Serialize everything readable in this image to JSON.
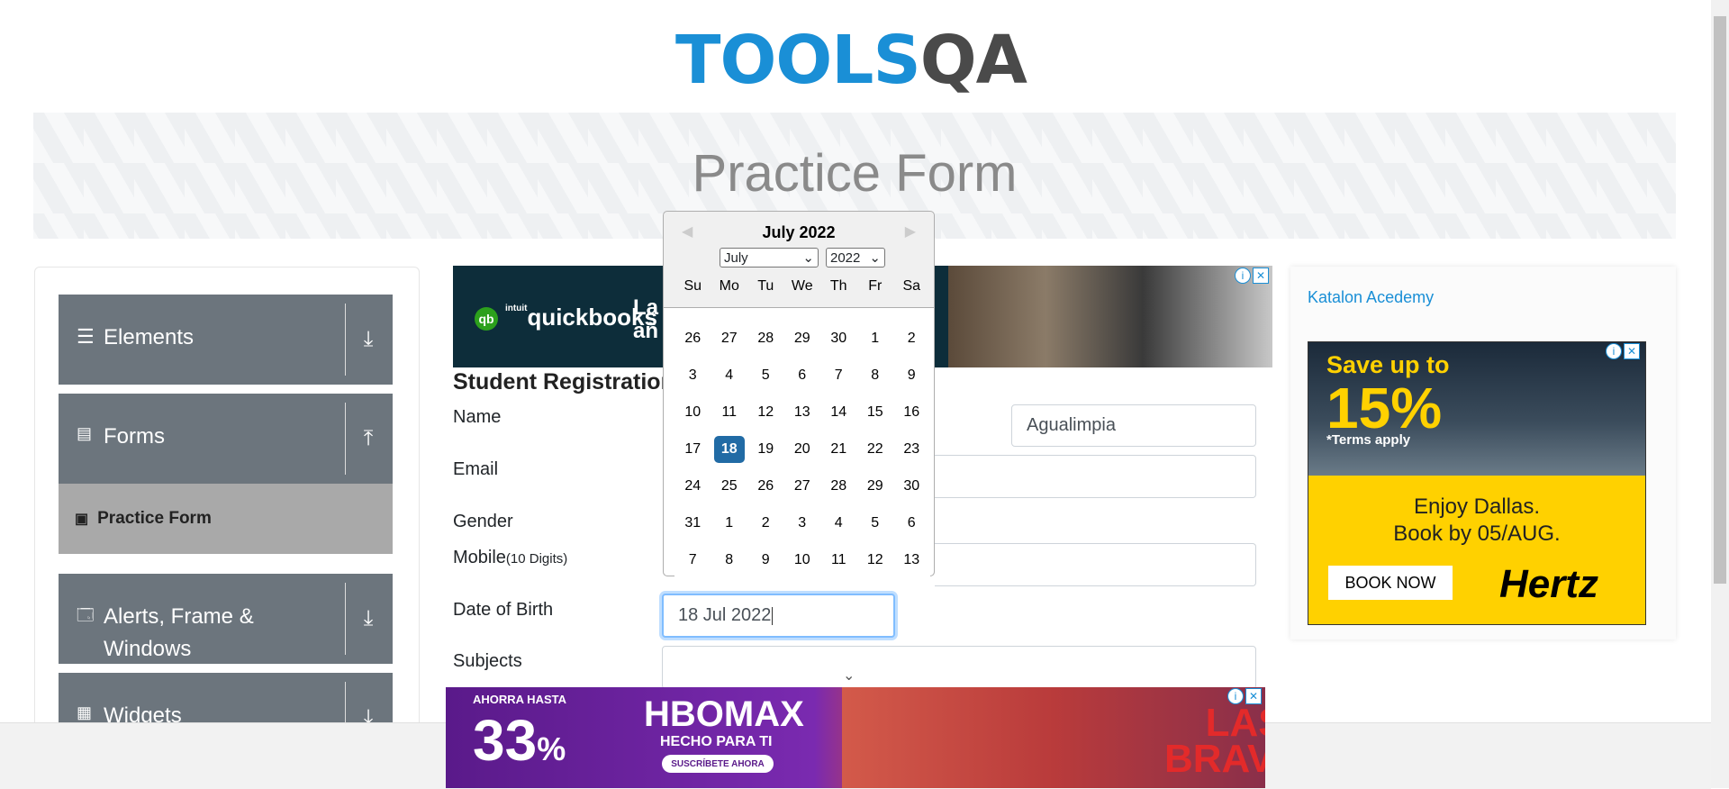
{
  "header": {
    "logo_part1": "TOOLS",
    "logo_part2": "QA",
    "page_title": "Practice Form"
  },
  "sidebar": {
    "groups": [
      {
        "label": "Elements",
        "icon": "menu-icon",
        "arrow": "download-icon"
      },
      {
        "label": "Forms",
        "icon": "document-icon",
        "arrow": "upload-icon"
      },
      {
        "label": "Alerts, Frame & Windows",
        "icon": "window-icon",
        "arrow": "download-icon"
      },
      {
        "label": "Widgets",
        "icon": "widgets-icon",
        "arrow": "download-icon"
      }
    ],
    "active_item": "Practice Form"
  },
  "ads": {
    "quickbooks_brand": "quickbooks",
    "quickbooks_small": "intuit",
    "quickbooks_text": "La\nañ",
    "katalon_alt": "Katalon Acedemy",
    "hertz": {
      "save": "Save up to",
      "percent": "15%",
      "terms": "*Terms apply",
      "enjoy": "Enjoy Dallas.",
      "book_by": "Book by 05/AUG.",
      "button": "BOOK NOW",
      "brand": "Hertz"
    },
    "hbo": {
      "top": "AHORRA HASTA",
      "percent": "33",
      "percent_sign": "%",
      "brand": "HBOMAX",
      "tagline": "HECHO PARA TI",
      "cta": "SUSCRÍBETE AHORA",
      "show": "LAS BRAVAS"
    }
  },
  "form": {
    "title": "Student Registration",
    "labels": {
      "name": "Name",
      "email": "Email",
      "gender": "Gender",
      "mobile": "Mobile",
      "mobile_hint": "(10 Digits)",
      "dob": "Date of Birth",
      "subjects": "Subjects"
    },
    "last_name_value": "Agualimpia",
    "dob_value": "18 Jul 2022"
  },
  "datepicker": {
    "header": "July 2022",
    "month_select": "July",
    "year_select": "2022",
    "weekdays": [
      "Su",
      "Mo",
      "Tu",
      "We",
      "Th",
      "Fr",
      "Sa"
    ],
    "days": [
      "26",
      "27",
      "28",
      "29",
      "30",
      "1",
      "2",
      "3",
      "4",
      "5",
      "6",
      "7",
      "8",
      "9",
      "10",
      "11",
      "12",
      "13",
      "14",
      "15",
      "16",
      "17",
      "18",
      "19",
      "20",
      "21",
      "22",
      "23",
      "24",
      "25",
      "26",
      "27",
      "28",
      "29",
      "30",
      "31",
      "1",
      "2",
      "3",
      "4",
      "5",
      "6",
      "7",
      "8",
      "9",
      "10",
      "11",
      "12",
      "13"
    ],
    "selected": "18"
  }
}
